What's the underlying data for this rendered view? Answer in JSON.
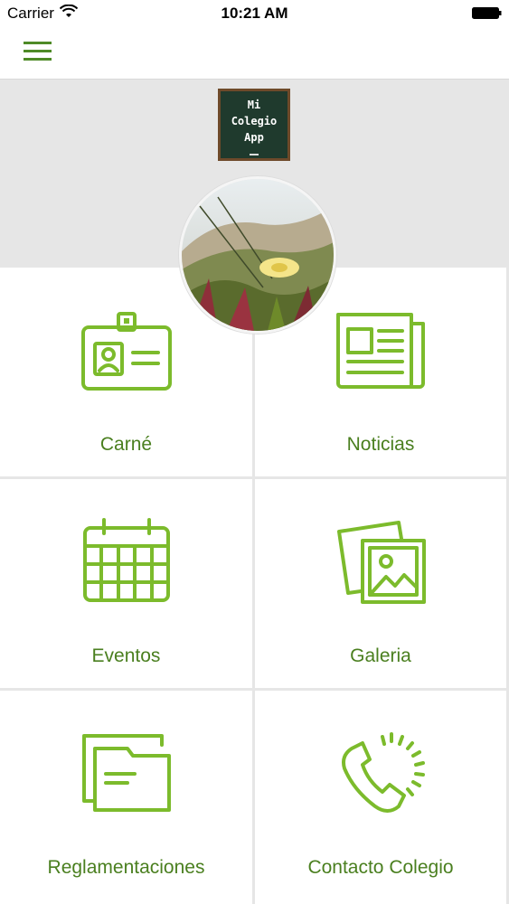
{
  "status_bar": {
    "carrier": "Carrier",
    "time": "10:21 AM"
  },
  "logo": {
    "line1": "Mi",
    "line2": "Colegio",
    "line3": "App"
  },
  "colors": {
    "accent": "#7cbb2c",
    "label": "#4a7f1f",
    "header_bg": "#e6e6e6"
  },
  "menu": [
    {
      "label": "Carné",
      "icon": "id-card-icon"
    },
    {
      "label": "Noticias",
      "icon": "newspaper-icon"
    },
    {
      "label": "Eventos",
      "icon": "calendar-icon"
    },
    {
      "label": "Galeria",
      "icon": "photo-gallery-icon"
    },
    {
      "label": "Reglamentaciones",
      "icon": "folder-icon"
    },
    {
      "label": "Contacto Colegio",
      "icon": "phone-icon"
    }
  ]
}
